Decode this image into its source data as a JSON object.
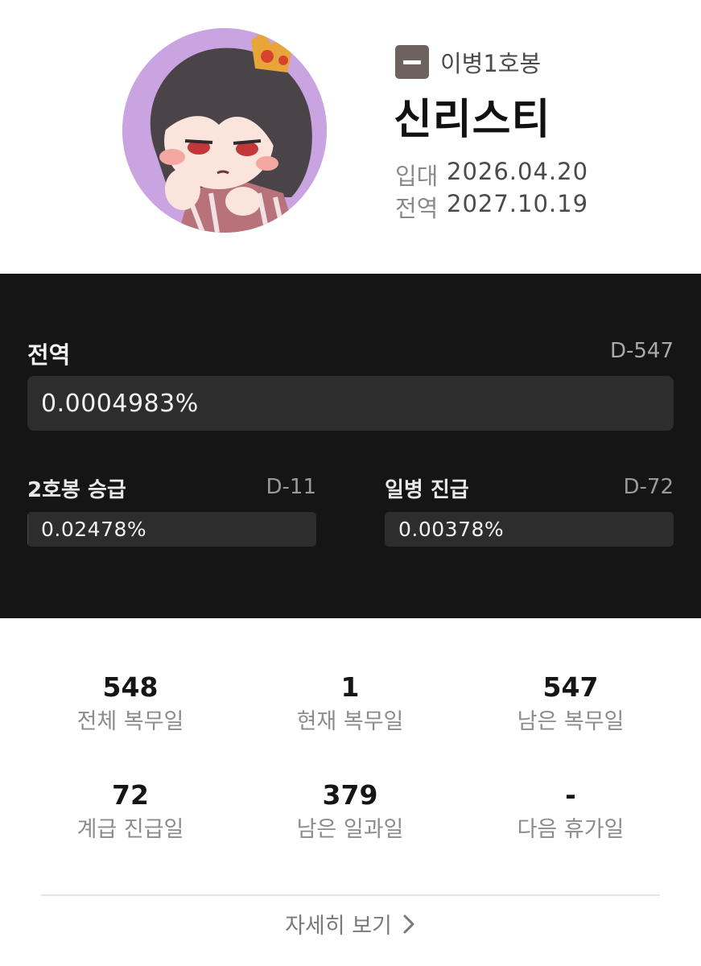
{
  "profile": {
    "rank": "이병1호봉",
    "name": "신리스티",
    "enlist_label": "입대",
    "enlist_date": "2026.04.20",
    "discharge_label": "전역",
    "discharge_date": "2027.10.19",
    "colors": {
      "rank_badge": "#6e6260",
      "avatar_bg": "#c9a4e0"
    }
  },
  "progress": {
    "main": {
      "label": "전역",
      "dday": "D-547",
      "percent_text": "0.0004983%",
      "fraction": 4.983e-06
    },
    "sub": [
      {
        "label": "2호봉 승급",
        "dday": "D-11",
        "percent_text": "0.02478%",
        "fraction": 0.0002478
      },
      {
        "label": "일병 진급",
        "dday": "D-72",
        "percent_text": "0.00378%",
        "fraction": 3.78e-05
      }
    ],
    "colors": {
      "background": "#151515",
      "track": "#2d2d2d"
    }
  },
  "stats": [
    {
      "value": "548",
      "label": "전체 복무일"
    },
    {
      "value": "1",
      "label": "현재 복무일"
    },
    {
      "value": "547",
      "label": "남은 복무일"
    },
    {
      "value": "72",
      "label": "계급 진급일"
    },
    {
      "value": "379",
      "label": "남은 일과일"
    },
    {
      "value": "-",
      "label": "다음 휴가일"
    }
  ],
  "detail_link": {
    "label": "자세히 보기",
    "icon": "chevron-right-icon"
  }
}
